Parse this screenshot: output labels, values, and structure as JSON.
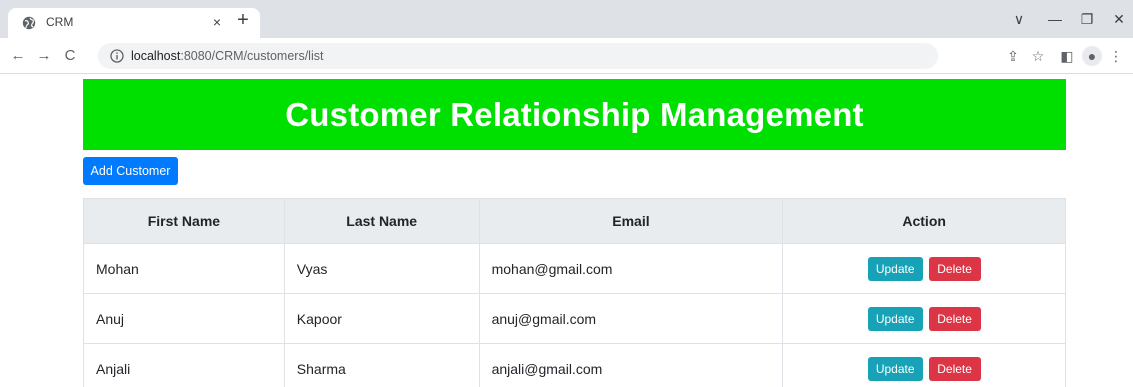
{
  "browser": {
    "tab_title": "CRM",
    "tab_close": "×",
    "new_tab": "+",
    "controls": {
      "dropdown": "∨",
      "minimize": "—",
      "restore": "❐",
      "close": "✕"
    },
    "nav": {
      "back": "←",
      "forward": "→",
      "reload": "C"
    },
    "url_host": "localhost",
    "url_rest": ":8080/CRM/customers/list",
    "toolbar_icons": {
      "share": "⇪",
      "bookmark": "☆",
      "sidepanel": "◧",
      "profile": "●",
      "menu": "⋮"
    }
  },
  "page": {
    "title": "Customer Relationship Management",
    "add_button": "Add Customer",
    "table": {
      "headers": [
        "First Name",
        "Last Name",
        "Email",
        "Action"
      ],
      "rows": [
        {
          "first": "Mohan",
          "last": "Vyas",
          "email": "mohan@gmail.com"
        },
        {
          "first": "Anuj",
          "last": "Kapoor",
          "email": "anuj@gmail.com"
        },
        {
          "first": "Anjali",
          "last": "Sharma",
          "email": "anjali@gmail.com"
        }
      ],
      "update_label": "Update",
      "delete_label": "Delete"
    }
  },
  "colors": {
    "banner": "#00e000",
    "primary": "#007bff",
    "info": "#17a2b8",
    "danger": "#dc3545",
    "table_header": "#e9ecef"
  }
}
